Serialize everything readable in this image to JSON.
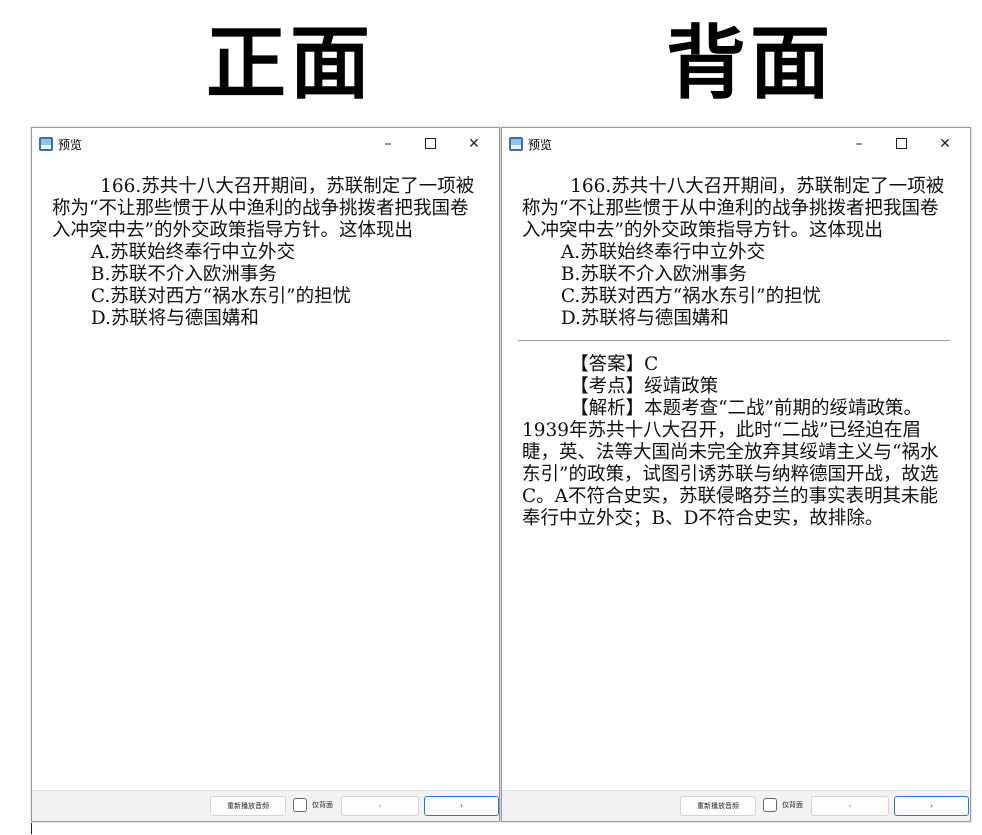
{
  "headings": {
    "front": "正面",
    "back": "背面"
  },
  "windows": {
    "front": {
      "title": "预览",
      "controls": {
        "minimize": "–",
        "close": "✕"
      }
    },
    "back": {
      "title": "预览",
      "controls": {
        "minimize": "–",
        "close": "✕"
      }
    }
  },
  "question": {
    "stem": "166.苏共十八大召开期间，苏联制定了一项被称为“不让那些惯于从中渔利的战争挑拨者把我国卷入冲突中去”的外交政策指导方针。这体现出",
    "options": [
      "A.苏联始终奉行中立外交",
      "B.苏联不介入欧洲事务",
      "C.苏联对西方“祸水东引”的担忧",
      "D.苏联将与德国媾和"
    ]
  },
  "answer": {
    "answer_line": "【答案】C",
    "topic_line": "【考点】绥靖政策",
    "analysis": "【解析】本题考查“二战”前期的绥靖政策。1939年苏共十八大召开，此时“二战”已经迫在眉睫，英、法等大国尚未完全放弃其绥靖主义与“祸水东引”的政策，试图引诱苏联与纳粹德国开战，故选C。A不符合史实，苏联侵略芬兰的事实表明其未能奉行中立外交；B、D不符合史实，故排除。"
  },
  "bottombar": {
    "replay_label": "重新播放音频",
    "back_only_label": "仅背面",
    "prev_label": "‹",
    "next_label": "›"
  }
}
